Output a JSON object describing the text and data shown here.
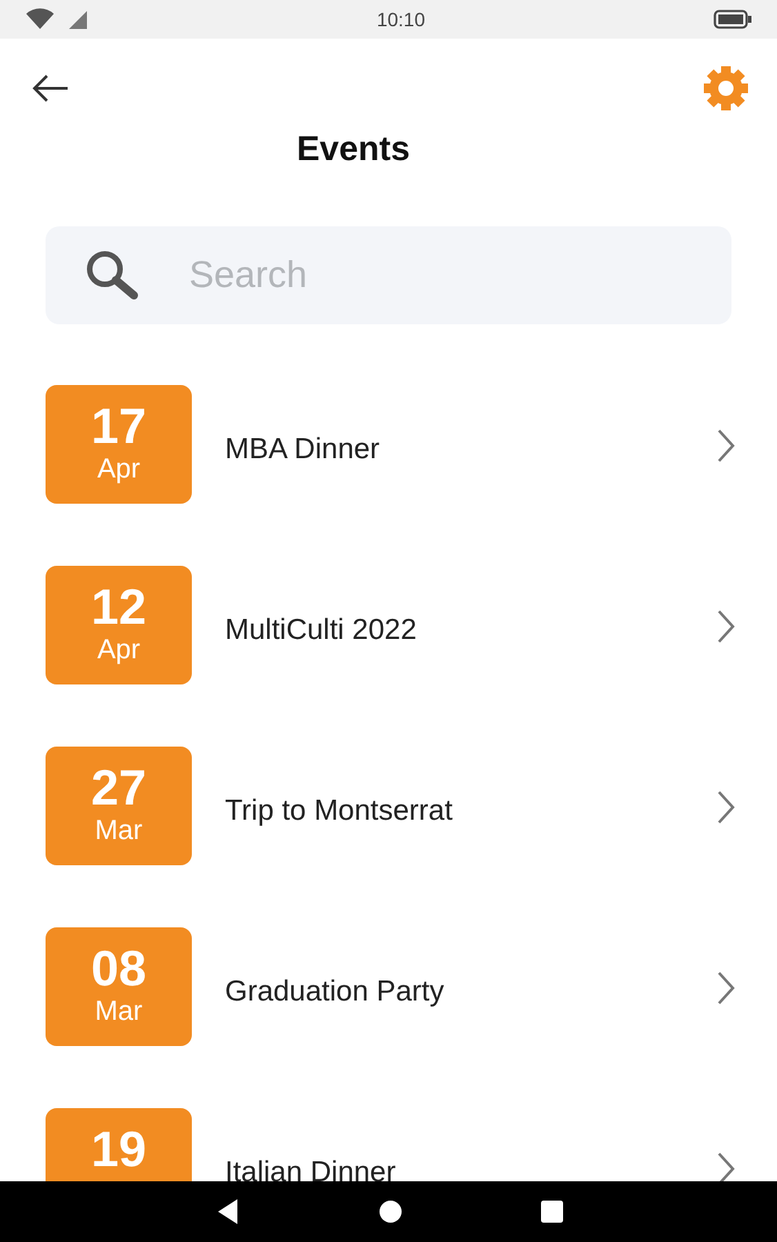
{
  "status_bar": {
    "time": "10:10"
  },
  "header": {
    "title": "Events"
  },
  "search": {
    "placeholder": "Search"
  },
  "events": [
    {
      "day": "17",
      "month": "Apr",
      "title": "MBA Dinner"
    },
    {
      "day": "12",
      "month": "Apr",
      "title": "MultiCulti 2022"
    },
    {
      "day": "27",
      "month": "Mar",
      "title": "Trip to Montserrat"
    },
    {
      "day": "08",
      "month": "Mar",
      "title": "Graduation Party"
    },
    {
      "day": "19",
      "title": "Italian Dinner"
    }
  ]
}
